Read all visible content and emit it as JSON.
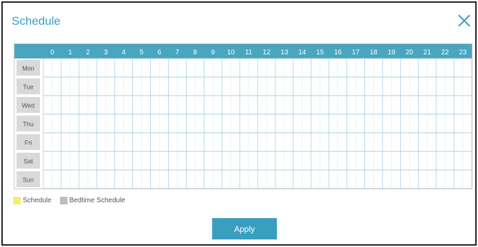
{
  "dialog": {
    "title": "Schedule",
    "close_icon": "close-icon"
  },
  "grid": {
    "hours": [
      "0",
      "1",
      "2",
      "3",
      "4",
      "5",
      "6",
      "7",
      "8",
      "9",
      "10",
      "11",
      "12",
      "13",
      "14",
      "15",
      "16",
      "17",
      "18",
      "19",
      "20",
      "21",
      "22",
      "23"
    ],
    "days": [
      "Mon",
      "Tue",
      "Wed",
      "Thu",
      "Fri",
      "Sat",
      "Sun"
    ],
    "header_color": "#4aa5bf",
    "day_label_bg": "#d9d9d9",
    "line_color": "#a8cfe0"
  },
  "legend": {
    "items": [
      {
        "label": "Schedule",
        "color": "#f2f06a"
      },
      {
        "label": "Bedtime Schedule",
        "color": "#bdbdbd"
      }
    ]
  },
  "buttons": {
    "apply_label": "Apply"
  }
}
